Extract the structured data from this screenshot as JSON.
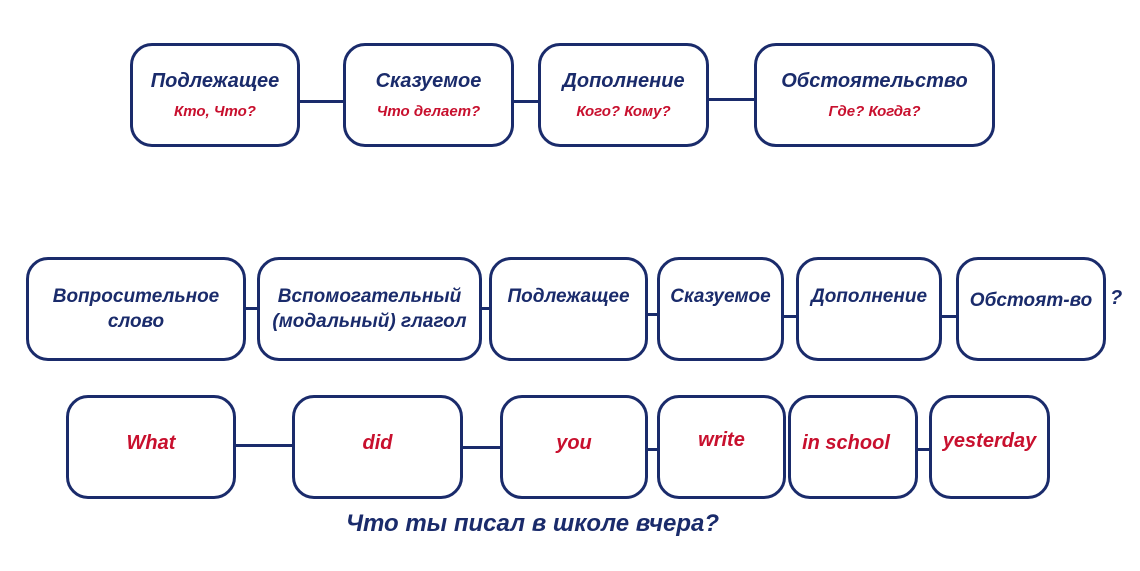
{
  "colors": {
    "primary": "#1a2b6b",
    "accent": "#c8102e"
  },
  "russian_order": [
    {
      "title": "Подлежащее",
      "question": "Кто, Что?"
    },
    {
      "title": "Сказуемое",
      "question": "Что делает?"
    },
    {
      "title": "Дополнение",
      "question": "Кого? Кому?"
    },
    {
      "title": "Обстоятельство",
      "question": "Где? Когда?"
    }
  ],
  "english_question_order": [
    {
      "title": "Вопросительное слово"
    },
    {
      "title": "Вспомогательный (модальный) глагол"
    },
    {
      "title": "Подлежащее"
    },
    {
      "title": "Сказуемое"
    },
    {
      "title": "Дополнение"
    },
    {
      "title": "Обстоят-во"
    }
  ],
  "question_mark": "?",
  "example_words": [
    "What",
    "did",
    "you",
    "write",
    "in school",
    "yesterday"
  ],
  "translation": "Что ты писал в школе вчера?"
}
